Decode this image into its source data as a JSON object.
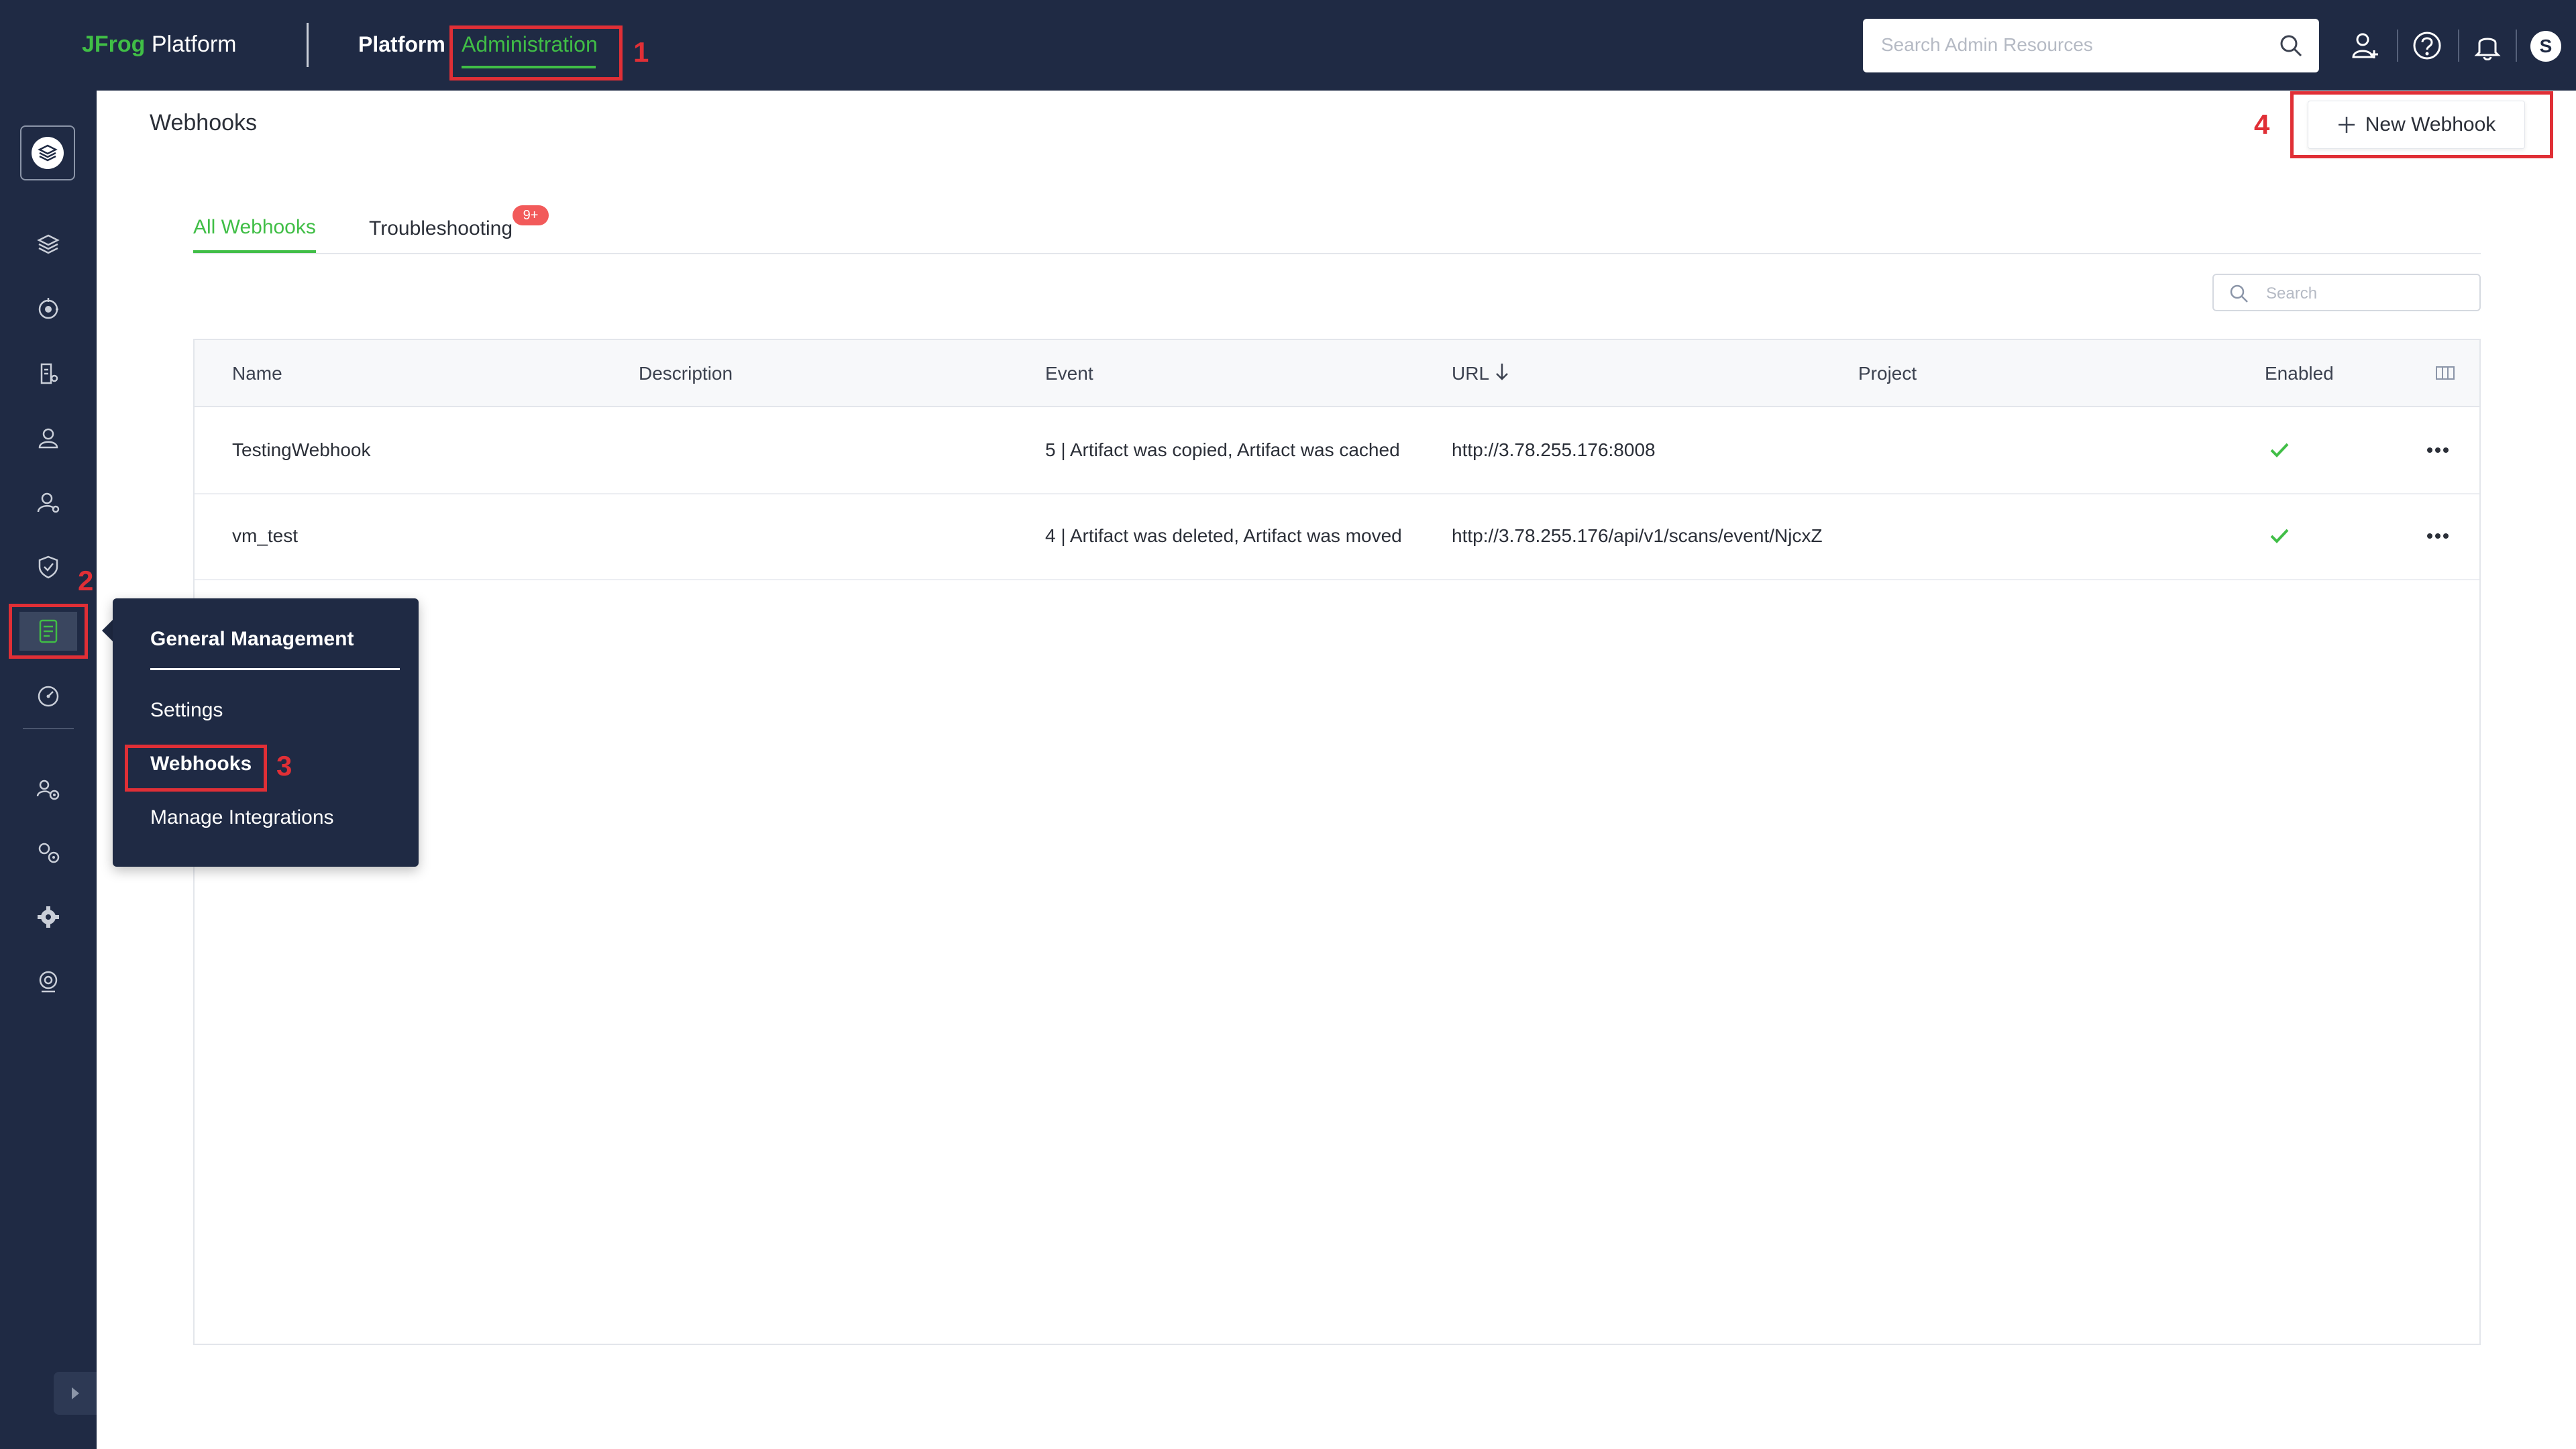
{
  "header": {
    "brand_accent": "JFrog",
    "brand_rest": " Platform",
    "nav": [
      {
        "label": "Platform"
      },
      {
        "label": "Administration"
      }
    ],
    "search_placeholder": "Search Admin Resources",
    "avatar_initial": "S"
  },
  "page": {
    "title": "Webhooks",
    "new_button": "New Webhook"
  },
  "tabs": [
    {
      "label": "All Webhooks",
      "active": true
    },
    {
      "label": "Troubleshooting",
      "badge": "9+"
    }
  ],
  "table_search_placeholder": "Search",
  "table": {
    "columns": [
      "Name",
      "Description",
      "Event",
      "URL",
      "Project",
      "Enabled"
    ],
    "rows": [
      {
        "name": "TestingWebhook",
        "description": "",
        "event": "5 | Artifact was copied, Artifact was cached",
        "url": "http://3.78.255.176:8008",
        "project": "",
        "enabled": true
      },
      {
        "name": "vm_test",
        "description": "",
        "event": "4 | Artifact was deleted, Artifact was moved",
        "url": "http://3.78.255.176/api/v1/scans/event/NjcxZ",
        "project": "",
        "enabled": true
      }
    ]
  },
  "flyout": {
    "title": "General Management",
    "items": [
      "Settings",
      "Webhooks",
      "Manage Integrations"
    ]
  },
  "annotations": [
    "1",
    "2",
    "3",
    "4"
  ],
  "colors": {
    "nav_bg": "#1f2a44",
    "accent_green": "#40be46",
    "annotation_red": "#e02f36",
    "badge_red": "#f25a5a"
  }
}
